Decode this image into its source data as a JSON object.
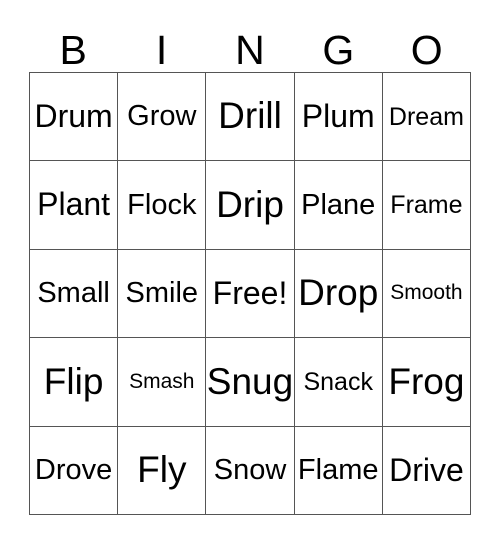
{
  "card": {
    "title": "BINGO",
    "header_letters": [
      "B",
      "I",
      "N",
      "G",
      "O"
    ],
    "columns": 5,
    "rows": 5,
    "border_color": "#555555",
    "background_color": "#ffffff",
    "text_color": "#000000",
    "free_space": "Free!",
    "free_space_position": {
      "row": 3,
      "column": 3
    },
    "cells": [
      [
        {
          "text": "Drum",
          "size": "fs-lg"
        },
        {
          "text": "Grow",
          "size": "fs-md"
        },
        {
          "text": "Drill",
          "size": "fs-xl"
        },
        {
          "text": "Plum",
          "size": "fs-lg"
        },
        {
          "text": "Dream",
          "size": "fs-sm"
        }
      ],
      [
        {
          "text": "Plant",
          "size": "fs-lg"
        },
        {
          "text": "Flock",
          "size": "fs-md"
        },
        {
          "text": "Drip",
          "size": "fs-xl"
        },
        {
          "text": "Plane",
          "size": "fs-md"
        },
        {
          "text": "Frame",
          "size": "fs-sm"
        }
      ],
      [
        {
          "text": "Small",
          "size": "fs-md"
        },
        {
          "text": "Smile",
          "size": "fs-md"
        },
        {
          "text": "Free!",
          "size": "fs-lg"
        },
        {
          "text": "Drop",
          "size": "fs-xl"
        },
        {
          "text": "Smooth",
          "size": "fs-xs"
        }
      ],
      [
        {
          "text": "Flip",
          "size": "fs-xl"
        },
        {
          "text": "Smash",
          "size": "fs-xs"
        },
        {
          "text": "Snug",
          "size": "fs-xl"
        },
        {
          "text": "Snack",
          "size": "fs-sm"
        },
        {
          "text": "Frog",
          "size": "fs-xl"
        }
      ],
      [
        {
          "text": "Drove",
          "size": "fs-md"
        },
        {
          "text": "Fly",
          "size": "fs-xl"
        },
        {
          "text": "Snow",
          "size": "fs-md"
        },
        {
          "text": "Flame",
          "size": "fs-md"
        },
        {
          "text": "Drive",
          "size": "fs-lg"
        }
      ]
    ]
  }
}
